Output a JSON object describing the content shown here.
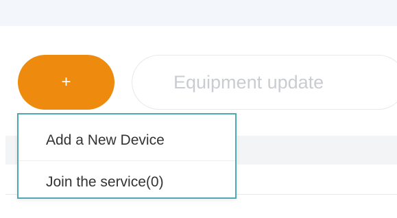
{
  "toolbar": {
    "add_label": "+",
    "update_label": "Equipment update"
  },
  "dropdown": {
    "items": [
      {
        "label": "Add a New Device"
      },
      {
        "label": "Join the service(0)"
      }
    ]
  },
  "colors": {
    "accent": "#ee8a0d",
    "dropdown_border": "#4fa7b3"
  }
}
